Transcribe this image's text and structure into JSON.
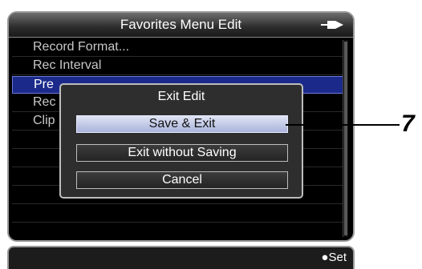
{
  "screen": {
    "title": "Favorites Menu Edit",
    "power_icon": "battery-plug-icon"
  },
  "menu": {
    "items": [
      {
        "label": "Record Format...",
        "selected": false
      },
      {
        "label": "Rec Interval",
        "selected": false
      },
      {
        "label": "Pre",
        "selected": true
      },
      {
        "label": "Rec",
        "selected": false
      },
      {
        "label": "Clip",
        "selected": false
      }
    ]
  },
  "dialog": {
    "title": "Exit Edit",
    "buttons": [
      {
        "label": "Save & Exit",
        "focused": true
      },
      {
        "label": "Exit without Saving",
        "focused": false
      },
      {
        "label": "Cancel",
        "focused": false
      }
    ]
  },
  "bottom": {
    "set_label": "●Set"
  },
  "callout": {
    "number": "7"
  },
  "colors": {
    "selection": "#1b2a8a",
    "focused_button": "#cdd3ee"
  }
}
